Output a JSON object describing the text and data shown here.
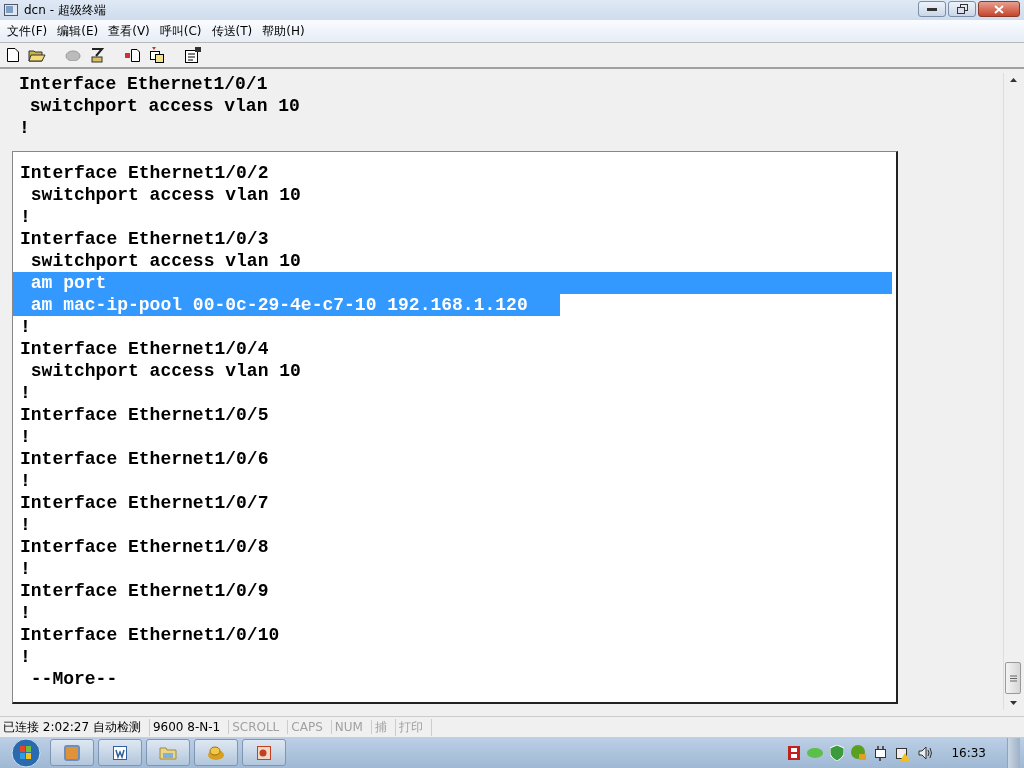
{
  "window": {
    "title": "dcn - 超级终端"
  },
  "menu": [
    "文件(F)",
    "编辑(E)",
    "查看(V)",
    "呼叫(C)",
    "传送(T)",
    "帮助(H)"
  ],
  "terminal": {
    "upper_lines": [
      {
        "text": "Interface Ethernet1/0/1",
        "selected": false
      },
      {
        "text": " switchport access vlan 10",
        "selected": false
      },
      {
        "text": "!",
        "selected": false
      }
    ],
    "framed_lines": [
      {
        "text": "Interface Ethernet1/0/2",
        "selected": false
      },
      {
        "text": " switchport access vlan 10",
        "selected": false
      },
      {
        "text": "!",
        "selected": false
      },
      {
        "text": "Interface Ethernet1/0/3",
        "selected": false
      },
      {
        "text": " switchport access vlan 10",
        "selected": false
      },
      {
        "text": " am port",
        "selected": true,
        "selection_to_line_end": true
      },
      {
        "text": " am mac-ip-pool 00-0c-29-4e-c7-10 192.168.1.120",
        "selected": true,
        "selection_to_line_end": false
      },
      {
        "text": "!",
        "selected": false
      },
      {
        "text": "Interface Ethernet1/0/4",
        "selected": false
      },
      {
        "text": " switchport access vlan 10",
        "selected": false
      },
      {
        "text": "!",
        "selected": false
      },
      {
        "text": "Interface Ethernet1/0/5",
        "selected": false
      },
      {
        "text": "!",
        "selected": false
      },
      {
        "text": "Interface Ethernet1/0/6",
        "selected": false
      },
      {
        "text": "!",
        "selected": false
      },
      {
        "text": "Interface Ethernet1/0/7",
        "selected": false
      },
      {
        "text": "!",
        "selected": false
      },
      {
        "text": "Interface Ethernet1/0/8",
        "selected": false
      },
      {
        "text": "!",
        "selected": false
      },
      {
        "text": "Interface Ethernet1/0/9",
        "selected": false
      },
      {
        "text": "!",
        "selected": false
      },
      {
        "text": "Interface Ethernet1/0/10",
        "selected": false
      },
      {
        "text": "!",
        "selected": false
      },
      {
        "text": " --More--",
        "selected": false
      }
    ]
  },
  "status_bar": [
    {
      "text": "已连接 2:02:27 自动检测",
      "disabled": false
    },
    {
      "text": "9600 8-N-1",
      "disabled": false
    },
    {
      "text": "SCROLL",
      "disabled": true
    },
    {
      "text": "CAPS",
      "disabled": true
    },
    {
      "text": "NUM",
      "disabled": true
    },
    {
      "text": "捕",
      "disabled": true
    },
    {
      "text": "打印",
      "disabled": true
    }
  ],
  "taskbar": {
    "clock": "16:33"
  }
}
